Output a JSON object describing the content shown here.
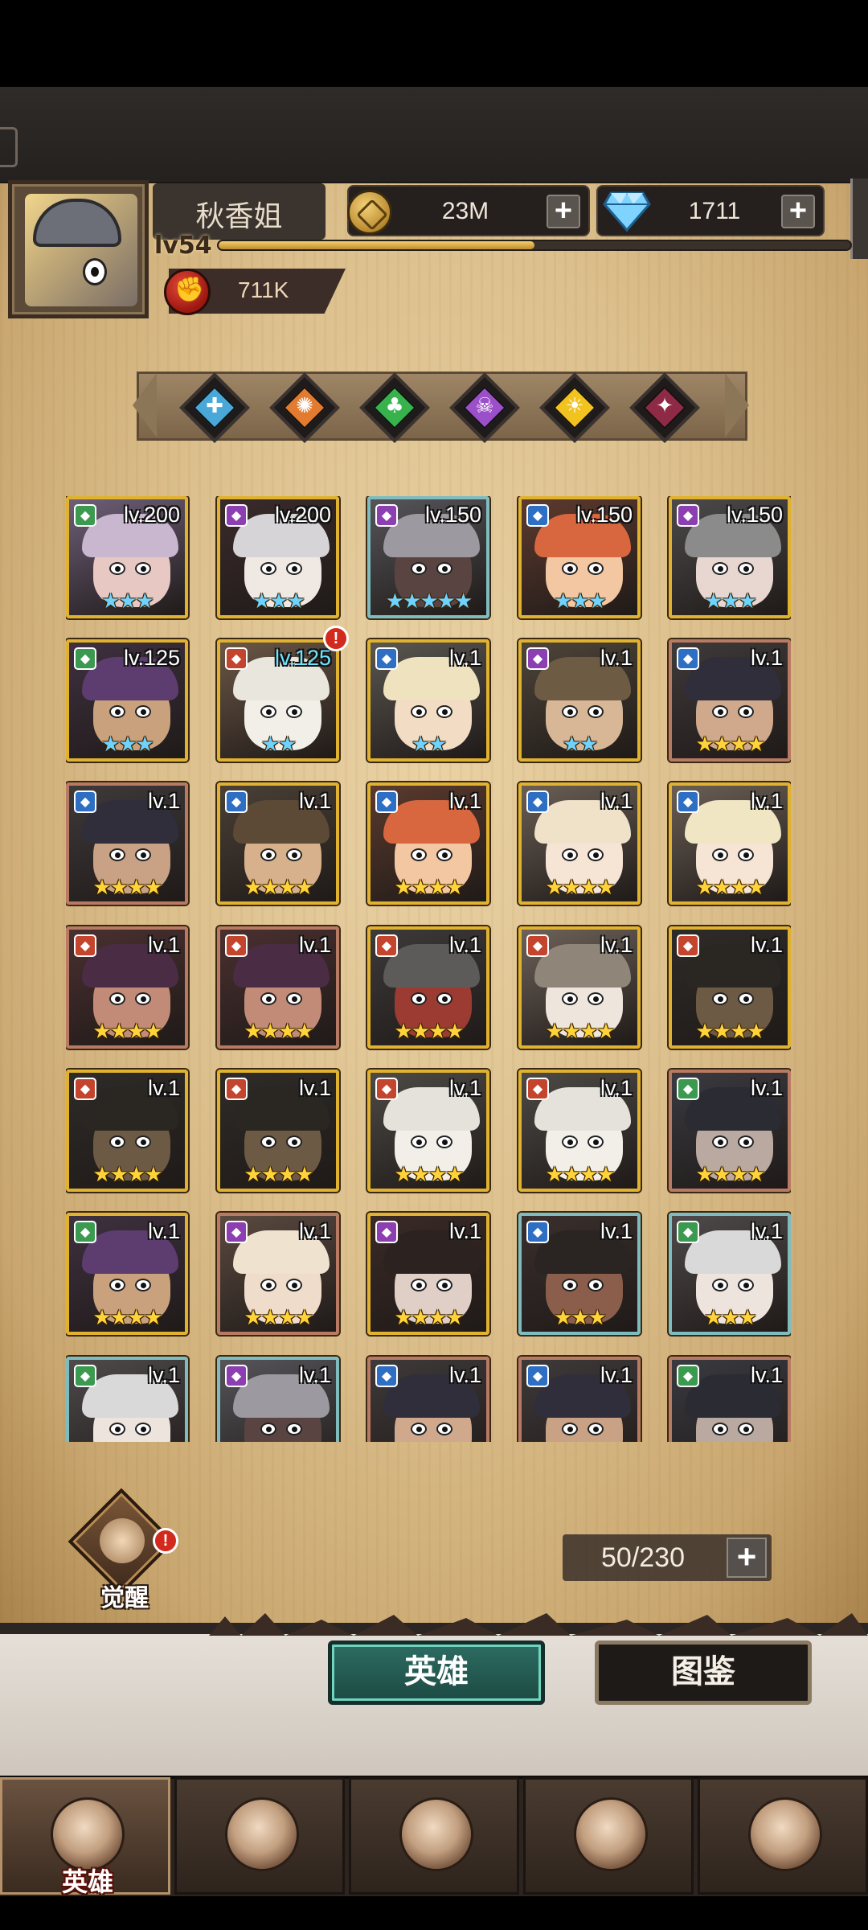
{
  "player": {
    "name": "秋香姐",
    "level_label": "lv54",
    "xp_fraction": 0.5,
    "power": "711K"
  },
  "resources": {
    "gold": "23M",
    "gems": "1711"
  },
  "factions": [
    {
      "icon": "cross-faction-icon",
      "color": "#4aa8d8",
      "glyph": "✚"
    },
    {
      "icon": "flame-faction-icon",
      "color": "#e27b2f",
      "glyph": "✺"
    },
    {
      "icon": "clover-faction-icon",
      "color": "#37b24d",
      "glyph": "♣"
    },
    {
      "icon": "skull-faction-icon",
      "color": "#9b4fc8",
      "glyph": "☠"
    },
    {
      "icon": "sun-faction-icon",
      "color": "#f2c21e",
      "glyph": "☀"
    },
    {
      "icon": "demon-faction-icon",
      "color": "#8e2a45",
      "glyph": "✦"
    }
  ],
  "heroes": [
    {
      "level": "lv.200",
      "stars": "★★★",
      "star_color": "blue",
      "frame": "gold",
      "cls_color": "#3c9a50",
      "bg": "#6d5f78",
      "hair": "#c9b6cf",
      "skin": "#e7c8c3"
    },
    {
      "level": "lv.200",
      "stars": "★★★",
      "star_color": "blue",
      "frame": "gold",
      "cls_color": "#8c3fb0",
      "bg": "#3a2b2b",
      "hair": "#d7d4d8",
      "skin": "#f0e8e2"
    },
    {
      "level": "lv.150",
      "stars": "★★★★★",
      "star_color": "blue",
      "frame": "teal",
      "cls_color": "#8c3fb0",
      "bg": "#56555a",
      "hair": "#9c9aa0",
      "skin": "#5a4442"
    },
    {
      "level": "lv.150",
      "stars": "★★★",
      "star_color": "blue",
      "frame": "gold",
      "cls_color": "#2e6fc4",
      "bg": "#5d3a2e",
      "hair": "#d8673f",
      "skin": "#f3c7a1"
    },
    {
      "level": "lv.150",
      "stars": "★★★",
      "star_color": "blue",
      "frame": "gold",
      "cls_color": "#8c3fb0",
      "bg": "#4c4a4a",
      "hair": "#8b8b8b",
      "skin": "#e8d7d1"
    },
    {
      "level": "lv.125",
      "stars": "★★★",
      "star_color": "blue",
      "frame": "gold",
      "cls_color": "#3c9a50",
      "bg": "#3f3140",
      "hair": "#5d3c70",
      "skin": "#c9a17d"
    },
    {
      "level": "lv.125",
      "stars": "★★",
      "star_color": "blue",
      "frame": "gold",
      "cls_color": "#c4452e",
      "bg": "#6b5746",
      "hair": "#e9e6de",
      "skin": "#f2efe8",
      "cyan": true,
      "alert": true
    },
    {
      "level": "lv.1",
      "stars": "★★",
      "star_color": "blue",
      "frame": "gold",
      "cls_color": "#2e6fc4",
      "bg": "#5a5650",
      "hair": "#efe2be",
      "skin": "#f3dcc4"
    },
    {
      "level": "lv.1",
      "stars": "★★",
      "star_color": "blue",
      "frame": "gold",
      "cls_color": "#8c3fb0",
      "bg": "#4e4539",
      "hair": "#6d5b44",
      "skin": "#d8b797"
    },
    {
      "level": "lv.1",
      "stars": "★★★★",
      "star_color": "gold",
      "frame": "copper",
      "cls_color": "#2e6fc4",
      "bg": "#3f3a3a",
      "hair": "#2f2e3a",
      "skin": "#d0a98d"
    },
    {
      "level": "lv.1",
      "stars": "★★★★",
      "star_color": "gold",
      "frame": "copper",
      "cls_color": "#2e6fc4",
      "bg": "#3f3a3a",
      "hair": "#2f2e3a",
      "skin": "#c9a285"
    },
    {
      "level": "lv.1",
      "stars": "★★★★",
      "star_color": "gold",
      "frame": "gold",
      "cls_color": "#2e6fc4",
      "bg": "#4a4036",
      "hair": "#5d4a36",
      "skin": "#d7b18b"
    },
    {
      "level": "lv.1",
      "stars": "★★★★",
      "star_color": "gold",
      "frame": "gold",
      "cls_color": "#2e6fc4",
      "bg": "#5b3a2e",
      "hair": "#d8673f",
      "skin": "#f3c7a1"
    },
    {
      "level": "lv.1",
      "stars": "★★★★",
      "star_color": "gold",
      "frame": "gold",
      "cls_color": "#2e6fc4",
      "bg": "#6a5f55",
      "hair": "#f0e2c8",
      "skin": "#f6e4d4"
    },
    {
      "level": "lv.1",
      "stars": "★★★★",
      "star_color": "gold",
      "frame": "gold",
      "cls_color": "#2e6fc4",
      "bg": "#6a5f55",
      "hair": "#f1e6c4",
      "skin": "#f6e4d4"
    },
    {
      "level": "lv.1",
      "stars": "★★★★",
      "star_color": "gold",
      "frame": "copper",
      "cls_color": "#c4452e",
      "bg": "#4a3030",
      "hair": "#4a2c45",
      "skin": "#c28b78"
    },
    {
      "level": "lv.1",
      "stars": "★★★★",
      "star_color": "gold",
      "frame": "copper",
      "cls_color": "#c4452e",
      "bg": "#4a3030",
      "hair": "#4a2c45",
      "skin": "#c28b78"
    },
    {
      "level": "lv.1",
      "stars": "★★★★",
      "star_color": "gold",
      "frame": "gold",
      "cls_color": "#c4452e",
      "bg": "#3d3a3a",
      "hair": "#5d5b5a",
      "skin": "#9b3b32"
    },
    {
      "level": "lv.1",
      "stars": "★★★★",
      "star_color": "gold",
      "frame": "gold",
      "cls_color": "#c4452e",
      "bg": "#6d6259",
      "hair": "#8f8679",
      "skin": "#eee6dc"
    },
    {
      "level": "lv.1",
      "stars": "★★★★",
      "star_color": "gold",
      "frame": "gold",
      "cls_color": "#c4452e",
      "bg": "#2e2b28",
      "hair": "#2a2622",
      "skin": "#6d5a44"
    },
    {
      "level": "lv.1",
      "stars": "★★★★",
      "star_color": "gold",
      "frame": "gold",
      "cls_color": "#c4452e",
      "bg": "#2e2b28",
      "hair": "#2a2622",
      "skin": "#6d5a44"
    },
    {
      "level": "lv.1",
      "stars": "★★★★",
      "star_color": "gold",
      "frame": "gold",
      "cls_color": "#c4452e",
      "bg": "#2e2b28",
      "hair": "#2a2622",
      "skin": "#6d5a44"
    },
    {
      "level": "lv.1",
      "stars": "★★★★",
      "star_color": "gold",
      "frame": "gold",
      "cls_color": "#c4452e",
      "bg": "#4d4a46",
      "hair": "#e5e2dc",
      "skin": "#f2efe8"
    },
    {
      "level": "lv.1",
      "stars": "★★★★",
      "star_color": "gold",
      "frame": "gold",
      "cls_color": "#c4452e",
      "bg": "#4d4a46",
      "hair": "#e5e2dc",
      "skin": "#f2efe8"
    },
    {
      "level": "lv.1",
      "stars": "★★★★",
      "star_color": "gold",
      "frame": "copper",
      "cls_color": "#3c9a50",
      "bg": "#3a3a40",
      "hair": "#2a2b33",
      "skin": "#b9a9a0"
    },
    {
      "level": "lv.1",
      "stars": "★★★★",
      "star_color": "gold",
      "frame": "gold",
      "cls_color": "#3c9a50",
      "bg": "#3f3140",
      "hair": "#5d3c70",
      "skin": "#c9a17d"
    },
    {
      "level": "lv.1",
      "stars": "★★★★",
      "star_color": "gold",
      "frame": "copper",
      "cls_color": "#8c3fb0",
      "bg": "#5b4a40",
      "hair": "#efe2cf",
      "skin": "#f0dccb"
    },
    {
      "level": "lv.1",
      "stars": "★★★★",
      "star_color": "gold",
      "frame": "gold",
      "cls_color": "#8c3fb0",
      "bg": "#3a2a26",
      "hair": "#2c2220",
      "skin": "#e0cfc6"
    },
    {
      "level": "lv.1",
      "stars": "★★★",
      "star_color": "gold",
      "frame": "teal",
      "cls_color": "#2e6fc4",
      "bg": "#3a2f2c",
      "hair": "#2a2422",
      "skin": "#8a5e4b"
    },
    {
      "level": "lv.1",
      "stars": "★★★",
      "star_color": "gold",
      "frame": "teal",
      "cls_color": "#3c9a50",
      "bg": "#4f4a4b",
      "hair": "#d9d9d9",
      "skin": "#eee4de"
    },
    {
      "level": "lv.1",
      "stars": "",
      "star_color": "gold",
      "frame": "teal",
      "cls_color": "#3c9a50",
      "bg": "#4f4a4b",
      "hair": "#d9d9d9",
      "skin": "#eee4de"
    },
    {
      "level": "lv.1",
      "stars": "",
      "star_color": "gold",
      "frame": "teal",
      "cls_color": "#8c3fb0",
      "bg": "#56555a",
      "hair": "#9c9aa0",
      "skin": "#5a4442"
    },
    {
      "level": "lv.1",
      "stars": "",
      "star_color": "gold",
      "frame": "copper",
      "cls_color": "#2e6fc4",
      "bg": "#3f3a3a",
      "hair": "#2f2e3a",
      "skin": "#d0a98d"
    },
    {
      "level": "lv.1",
      "stars": "",
      "star_color": "gold",
      "frame": "copper",
      "cls_color": "#2e6fc4",
      "bg": "#3f3a3a",
      "hair": "#2f2e3a",
      "skin": "#c9a285"
    },
    {
      "level": "lv.1",
      "stars": "",
      "star_color": "gold",
      "frame": "copper",
      "cls_color": "#3c9a50",
      "bg": "#3a3a40",
      "hair": "#2a2b33",
      "skin": "#b9a9a0"
    }
  ],
  "awaken": {
    "label": "觉醒"
  },
  "capacity": {
    "text": "50/230"
  },
  "tabs": {
    "heroes": "英雄",
    "codex": "图鉴"
  },
  "nav": {
    "items": [
      {
        "icon": "knight-helmet-icon",
        "label": "英雄",
        "active": true
      },
      {
        "icon": "war-flag-icon",
        "label": ""
      },
      {
        "icon": "crossed-swords-icon",
        "label": ""
      },
      {
        "icon": "castle-tower-icon",
        "label": ""
      },
      {
        "icon": "guild-emblem-icon",
        "label": ""
      }
    ]
  },
  "colors": {
    "accent_teal": "#2d6c62",
    "frame_gold": "#d9a92b",
    "alert_red": "#d22a1d"
  }
}
